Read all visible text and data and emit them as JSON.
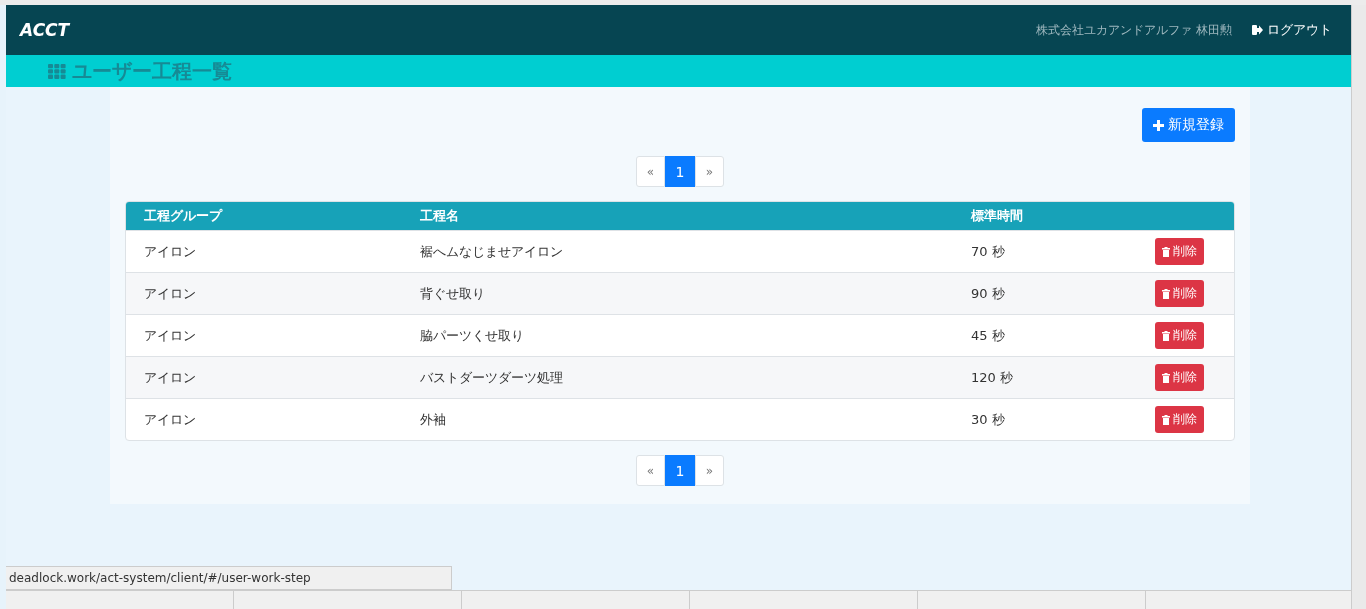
{
  "header": {
    "logo": "ACCT",
    "user": "株式会社ユカアンドアルファ 林田勲",
    "logout": "ログアウト"
  },
  "page_title": "ユーザー工程一覧",
  "new_button": "新規登録",
  "pagination_top": {
    "prev": "«",
    "next": "»",
    "pages": [
      {
        "label": "1",
        "selected": true
      }
    ]
  },
  "table": {
    "columns": [
      "工程グループ",
      "工程名",
      "標準時間"
    ],
    "rows": [
      {
        "group": "アイロン",
        "name": "裾へムなじませアイロン",
        "time": "70 秒",
        "delete": "削除"
      },
      {
        "group": "アイロン",
        "name": "背ぐせ取り",
        "time": "90 秒",
        "delete": "削除"
      },
      {
        "group": "アイロン",
        "name": "脇パーツくせ取り",
        "time": "45 秒",
        "delete": "削除"
      },
      {
        "group": "アイロン",
        "name": "バストダーツダーツ処理",
        "time": "120 秒",
        "delete": "削除"
      },
      {
        "group": "アイロン",
        "name": "外袖",
        "time": "30 秒",
        "delete": "削除"
      }
    ]
  },
  "pagination_bottom": {
    "prev": "«",
    "next": "»",
    "pages": [
      {
        "label": "1",
        "selected": true
      }
    ]
  },
  "status_url": "deadlock.work/act-system/client/#/user-work-step"
}
